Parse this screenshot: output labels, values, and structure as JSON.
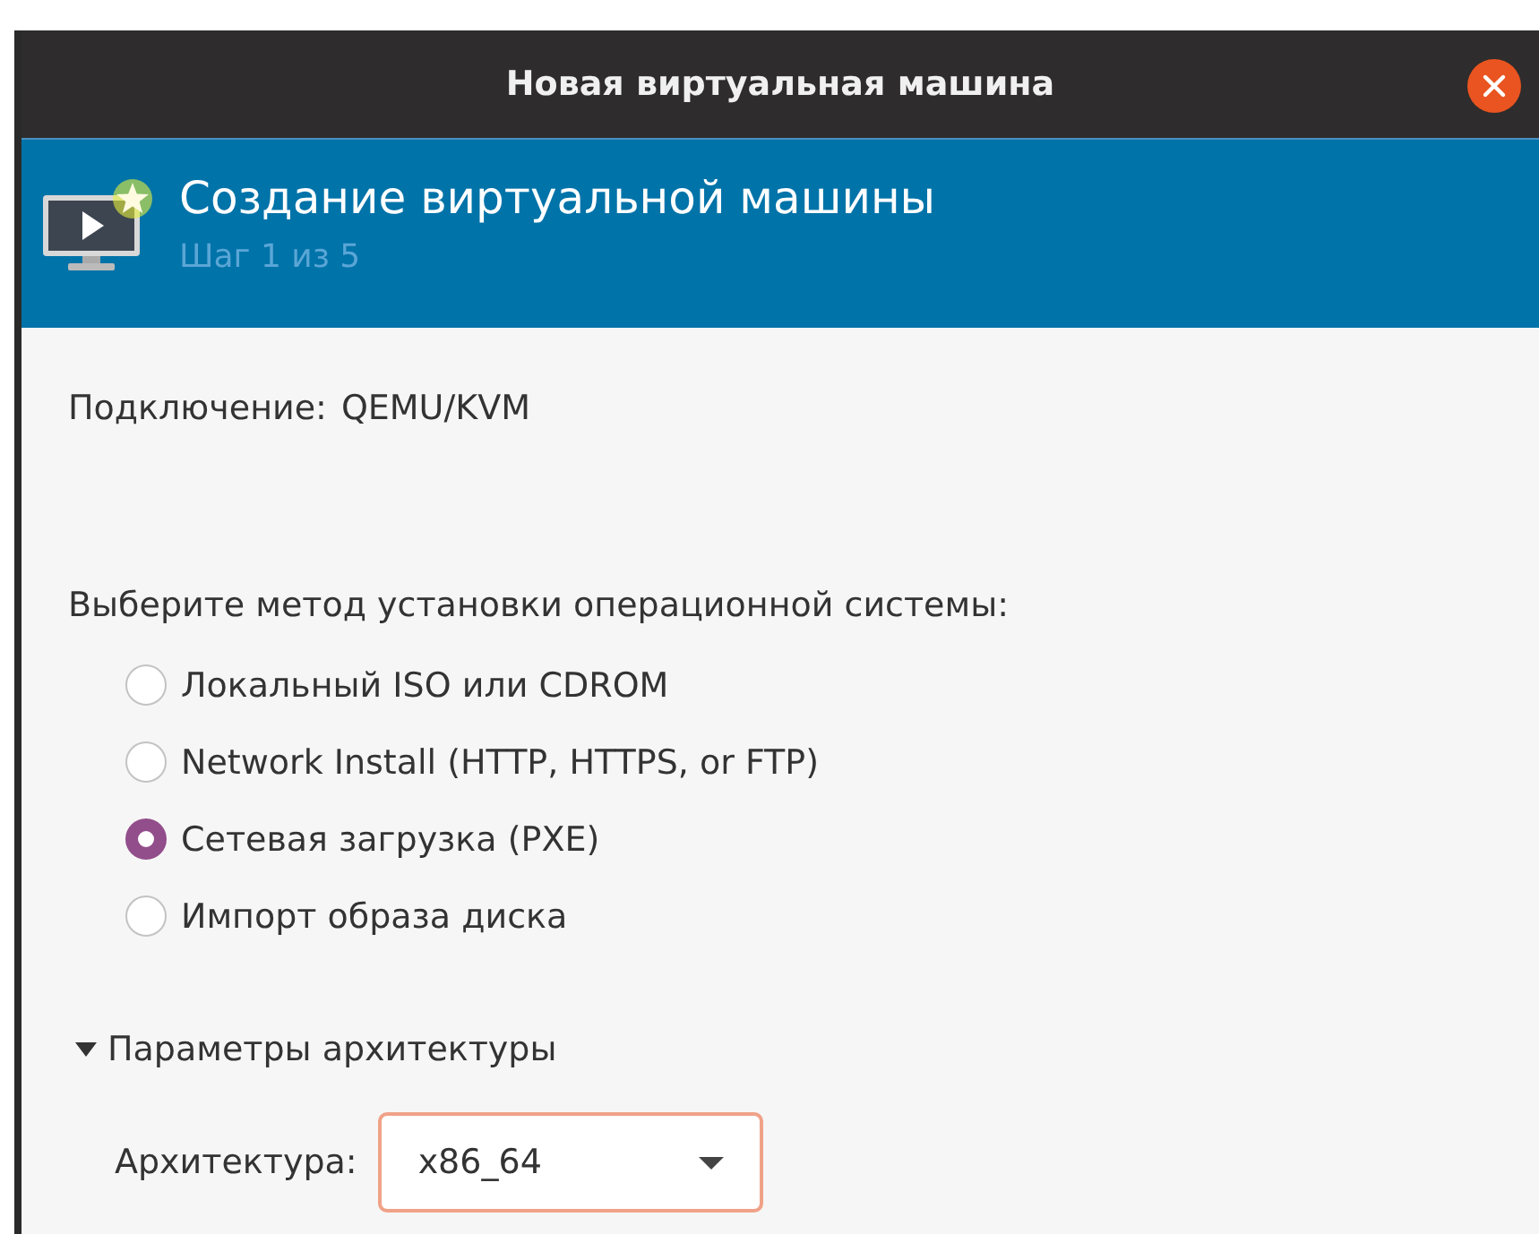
{
  "window": {
    "title": "Новая виртуальная машина"
  },
  "header": {
    "title": "Создание виртуальной машины",
    "step": "Шаг 1 из 5"
  },
  "connection": {
    "label": "Подключение:",
    "value": "QEMU/KVM"
  },
  "install_method": {
    "label": "Выберите метод установки операционной системы:",
    "options": [
      {
        "label": "Локальный ISO или CDROM",
        "selected": false
      },
      {
        "label": "Network Install (HTTP, HTTPS, or FTP)",
        "selected": false
      },
      {
        "label": "Сетевая загрузка (PXE)",
        "selected": true
      },
      {
        "label": "Импорт образа диска",
        "selected": false
      }
    ]
  },
  "architecture": {
    "expander": "Параметры архитектуры",
    "expanded": true,
    "label": "Архитектура:",
    "value": "x86_64",
    "focused": true
  }
}
